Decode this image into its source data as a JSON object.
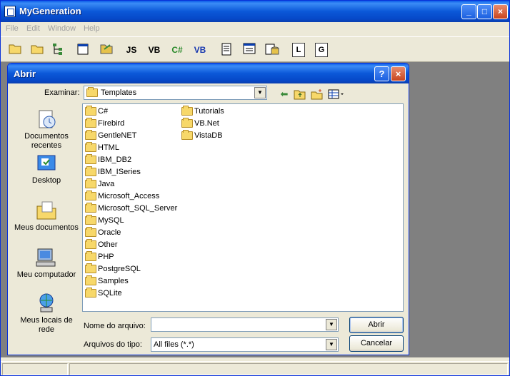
{
  "app": {
    "title": "MyGeneration",
    "window_buttons": {
      "minimize": "_",
      "maximize": "□",
      "close": "×"
    }
  },
  "menu": [
    "File",
    "Edit",
    "Window",
    "Help"
  ],
  "toolbar": {
    "js_label": "JS",
    "vb_label": "VB",
    "csharp_label": "C#",
    "vb2_label": "VB",
    "l_label": "L",
    "g_label": "G"
  },
  "dialog": {
    "title": "Abrir",
    "help_label": "?",
    "close_label": "×",
    "look_in_label": "Examinar:",
    "look_in_value": "Templates",
    "places": [
      {
        "label": "Documentos recentes",
        "icon": "recent-documents-icon"
      },
      {
        "label": "Desktop",
        "icon": "desktop-icon"
      },
      {
        "label": "Meus documentos",
        "icon": "my-documents-icon"
      },
      {
        "label": "Meu computador",
        "icon": "my-computer-icon"
      },
      {
        "label": "Meus locais de rede",
        "icon": "network-places-icon"
      }
    ],
    "files": [
      "C#",
      "Firebird",
      "GentleNET",
      "HTML",
      "IBM_DB2",
      "IBM_ISeries",
      "Java",
      "Microsoft_Access",
      "Microsoft_SQL_Server",
      "MySQL",
      "Oracle",
      "Other",
      "PHP",
      "PostgreSQL",
      "Samples",
      "SQLite",
      "Tutorials",
      "VB.Net",
      "VistaDB"
    ],
    "filename_label": "Nome do arquivo:",
    "filename_value": "",
    "filetype_label": "Arquivos do tipo:",
    "filetype_value": "All files (*.*)",
    "open_button": "Abrir",
    "cancel_button": "Cancelar"
  }
}
